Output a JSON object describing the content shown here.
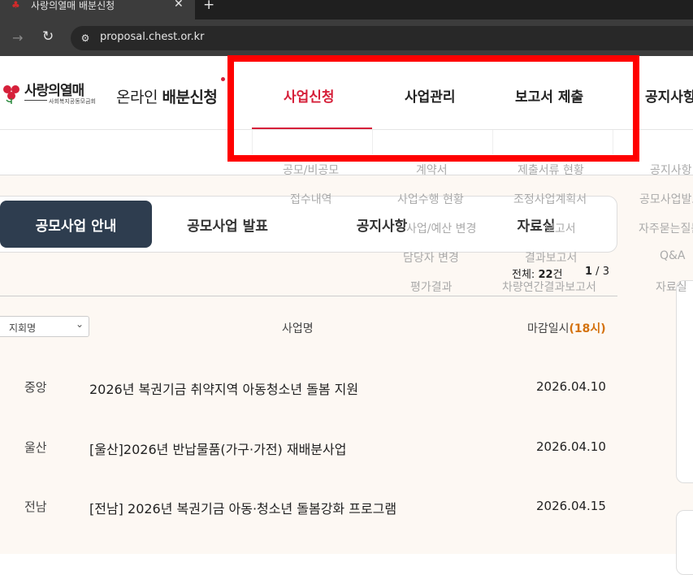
{
  "browser": {
    "tab_title": "사랑의열매 배분신청",
    "close_glyph": "✕",
    "new_tab_glyph": "+",
    "url": "proposal.chest.or.kr"
  },
  "header": {
    "logo_brand": "사랑의열매",
    "logo_sub": "사회복지공동모금회",
    "service_prefix": "온라인 ",
    "service_bold": "배분신청",
    "nav": [
      {
        "label": "사업신청",
        "active": true
      },
      {
        "label": "사업관리",
        "active": false
      },
      {
        "label": "보고서 제출",
        "active": false
      },
      {
        "label": "공지사항",
        "active": false
      }
    ]
  },
  "submenu": {
    "col1": [
      "공모/비공모",
      "접수내역"
    ],
    "col2": [
      "계약서",
      "사업수행 현황",
      "사업/예산 변경",
      "담당자 변경",
      "평가결과"
    ],
    "col3": [
      "제출서류 현황",
      "조정사업계획서",
      "보고서",
      "결과보고서",
      "차량연간결과보고서"
    ],
    "col4": [
      "공지사항",
      "공모사업발표",
      "자주묻는질문",
      "Q&A",
      "자료실"
    ]
  },
  "content_tabs": [
    {
      "label": "공모사업 안내",
      "active": true
    },
    {
      "label": "공모사업 발표",
      "active": false
    },
    {
      "label": "공지사항",
      "active": false
    },
    {
      "label": "자료실",
      "active": false
    }
  ],
  "list": {
    "count_label": "전체:",
    "count_value": "22",
    "count_unit": "건",
    "page_current": "1",
    "page_sep": " / ",
    "page_total": "3",
    "region_filter": "지회명",
    "col_title": "사업명",
    "col_deadline": "마감일시",
    "col_deadline_hl": "(18시)",
    "rows": [
      {
        "region": "중앙",
        "title": "2026년 복권기금 취약지역 아동청소년 돌봄 지원",
        "date": "2026.04.10"
      },
      {
        "region": "울산",
        "title": "[울산]2026년 반납물품(가구·가전) 재배분사업",
        "date": "2026.04.10"
      },
      {
        "region": "전남",
        "title": "[전남] 2026년 복권기금 아동·청소년 돌봄강화 프로그램",
        "date": "2026.04.15"
      }
    ]
  },
  "colors": {
    "accent": "#d6203a",
    "tab_active_bg": "#2e3d4f",
    "deadline_hl": "#d4720f",
    "highlight_box": "#ff0000"
  }
}
